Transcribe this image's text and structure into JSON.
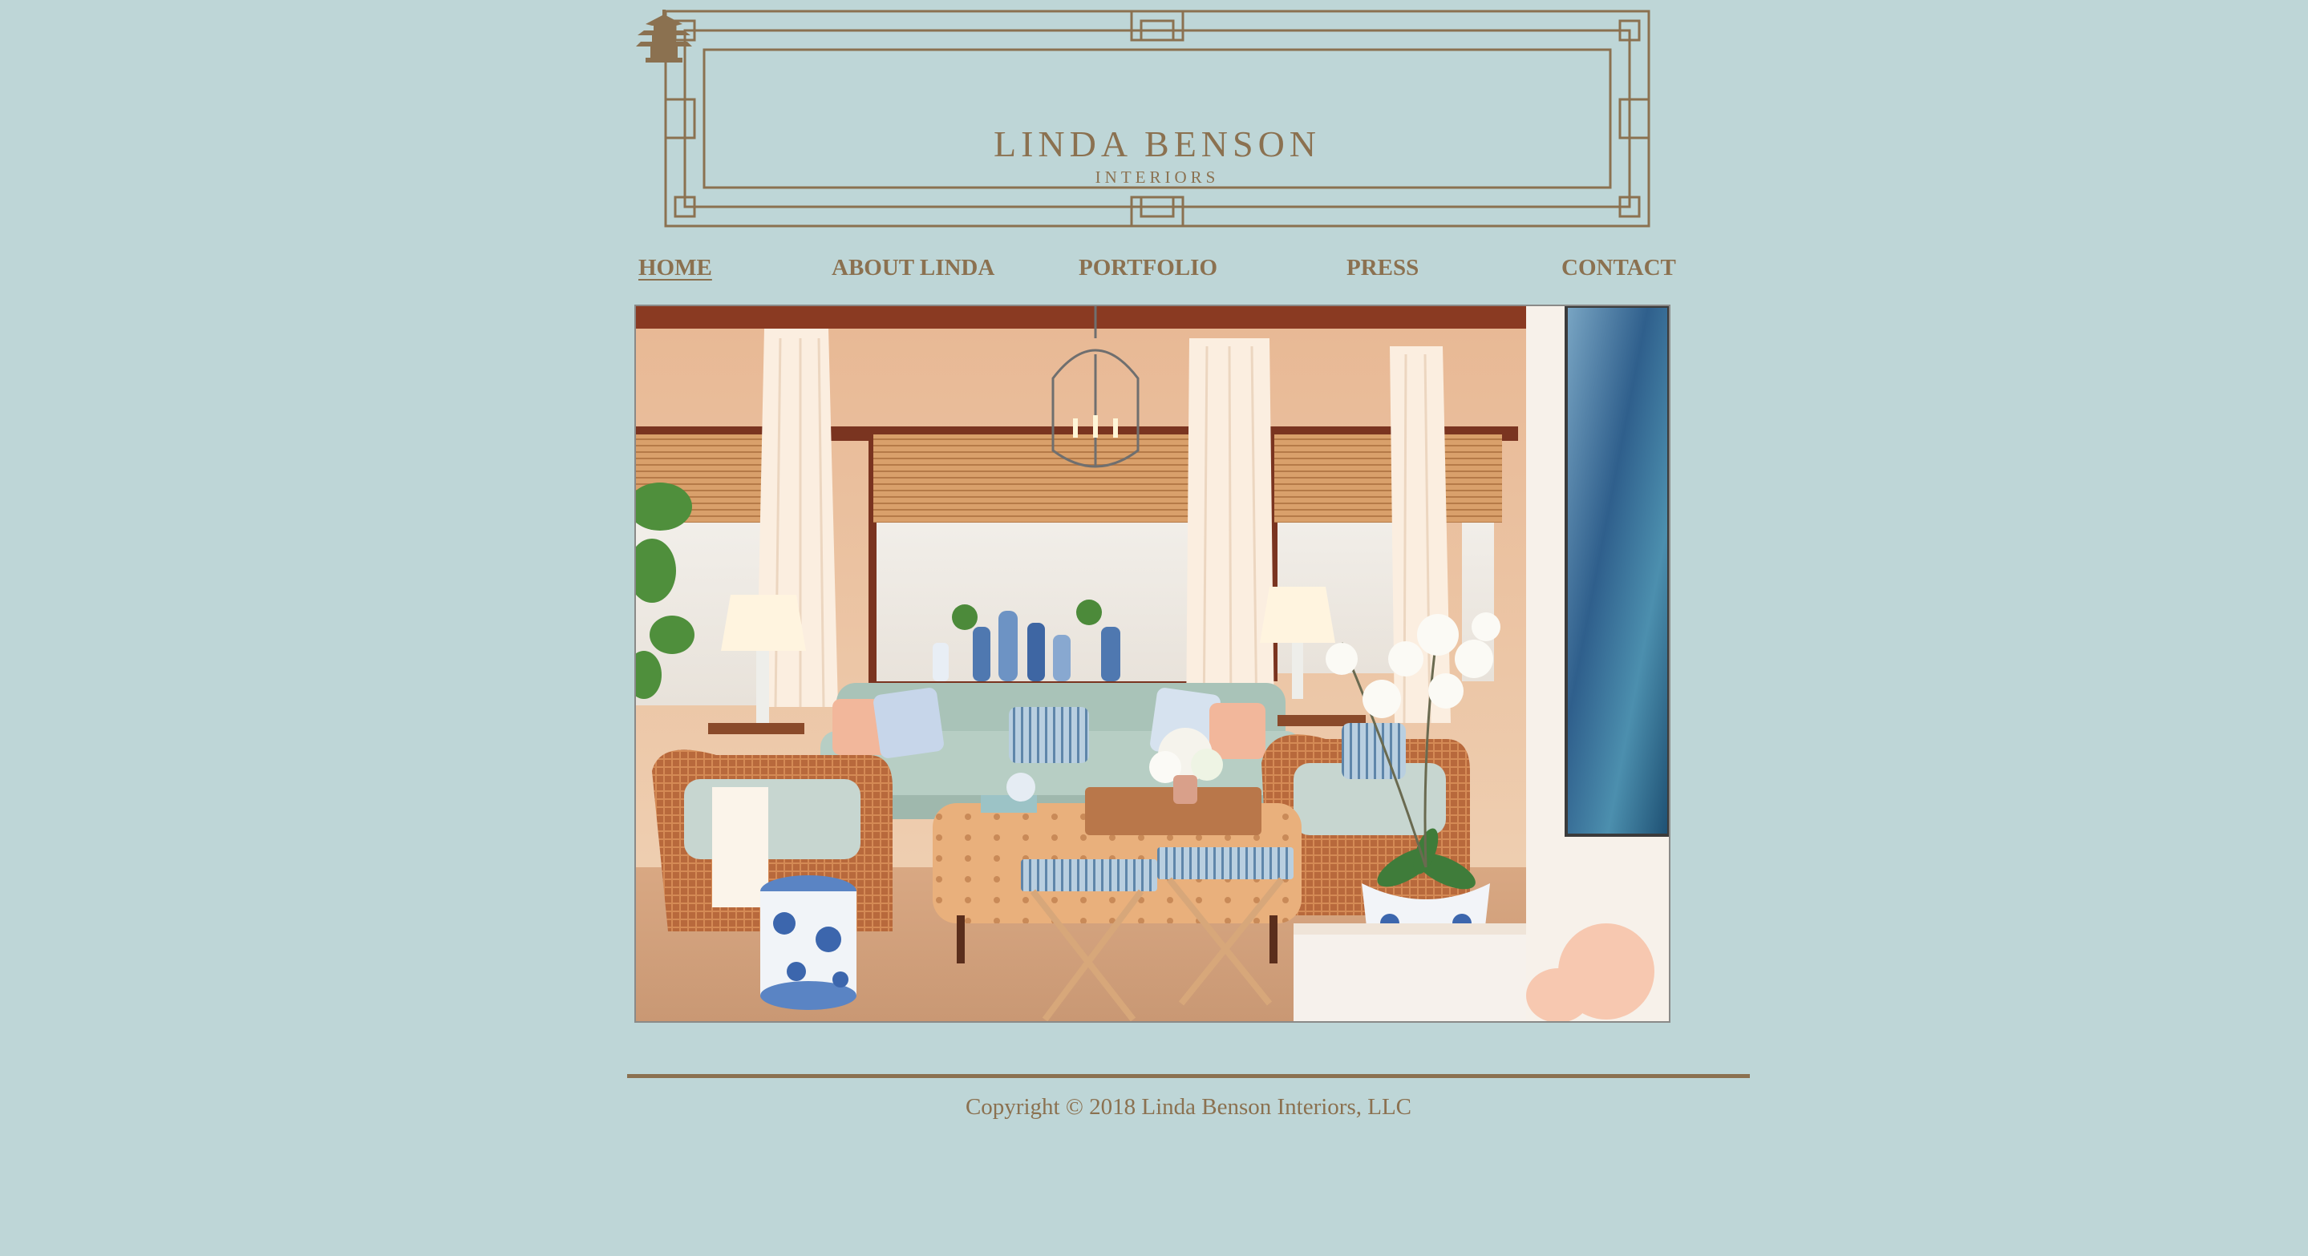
{
  "brand": {
    "name": "LINDA BENSON",
    "tagline": "INTERIORS"
  },
  "nav": {
    "items": [
      {
        "label": "HOME",
        "active": true
      },
      {
        "label": "ABOUT LINDA",
        "active": false
      },
      {
        "label": "PORTFOLIO",
        "active": false
      },
      {
        "label": "PRESS",
        "active": false
      },
      {
        "label": "CONTACT",
        "active": false
      }
    ]
  },
  "footer": {
    "copyright": "Copyright © 2018 Linda Benson Interiors, LLC"
  },
  "colors": {
    "background": "#bed6d7",
    "accent": "#8b7150"
  }
}
